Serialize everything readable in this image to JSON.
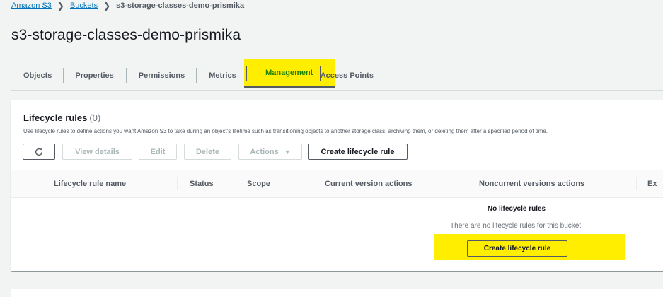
{
  "breadcrumb": {
    "items": [
      "Amazon S3",
      "Buckets"
    ],
    "current": "s3-storage-classes-demo-prismika"
  },
  "page_title": "s3-storage-classes-demo-prismika",
  "tabs": [
    {
      "label": "Objects"
    },
    {
      "label": "Properties"
    },
    {
      "label": "Permissions"
    },
    {
      "label": "Metrics"
    },
    {
      "label": "Management",
      "active": true
    },
    {
      "label": "Access Points"
    }
  ],
  "lifecycle": {
    "title": "Lifecycle rules",
    "count": "(0)",
    "description": "Use lifecycle rules to define actions you want Amazon S3 to take during an object's lifetime such as transitioning objects to another storage class, archiving them, or deleting them after a specified period of time.",
    "actions": {
      "refresh_icon": "refresh-icon",
      "view_details": "View details",
      "edit": "Edit",
      "delete": "Delete",
      "actions": "Actions",
      "create": "Create lifecycle rule"
    },
    "columns": [
      "Lifecycle rule name",
      "Status",
      "Scope",
      "Current version actions",
      "Noncurrent versions actions",
      "Ex"
    ],
    "empty": {
      "title": "No lifecycle rules",
      "description": "There are no lifecycle rules for this bucket.",
      "button": "Create lifecycle rule"
    }
  },
  "colors": {
    "highlight": "#ffee00",
    "link": "#0073bb",
    "active_tab_text": "#1d8102"
  }
}
